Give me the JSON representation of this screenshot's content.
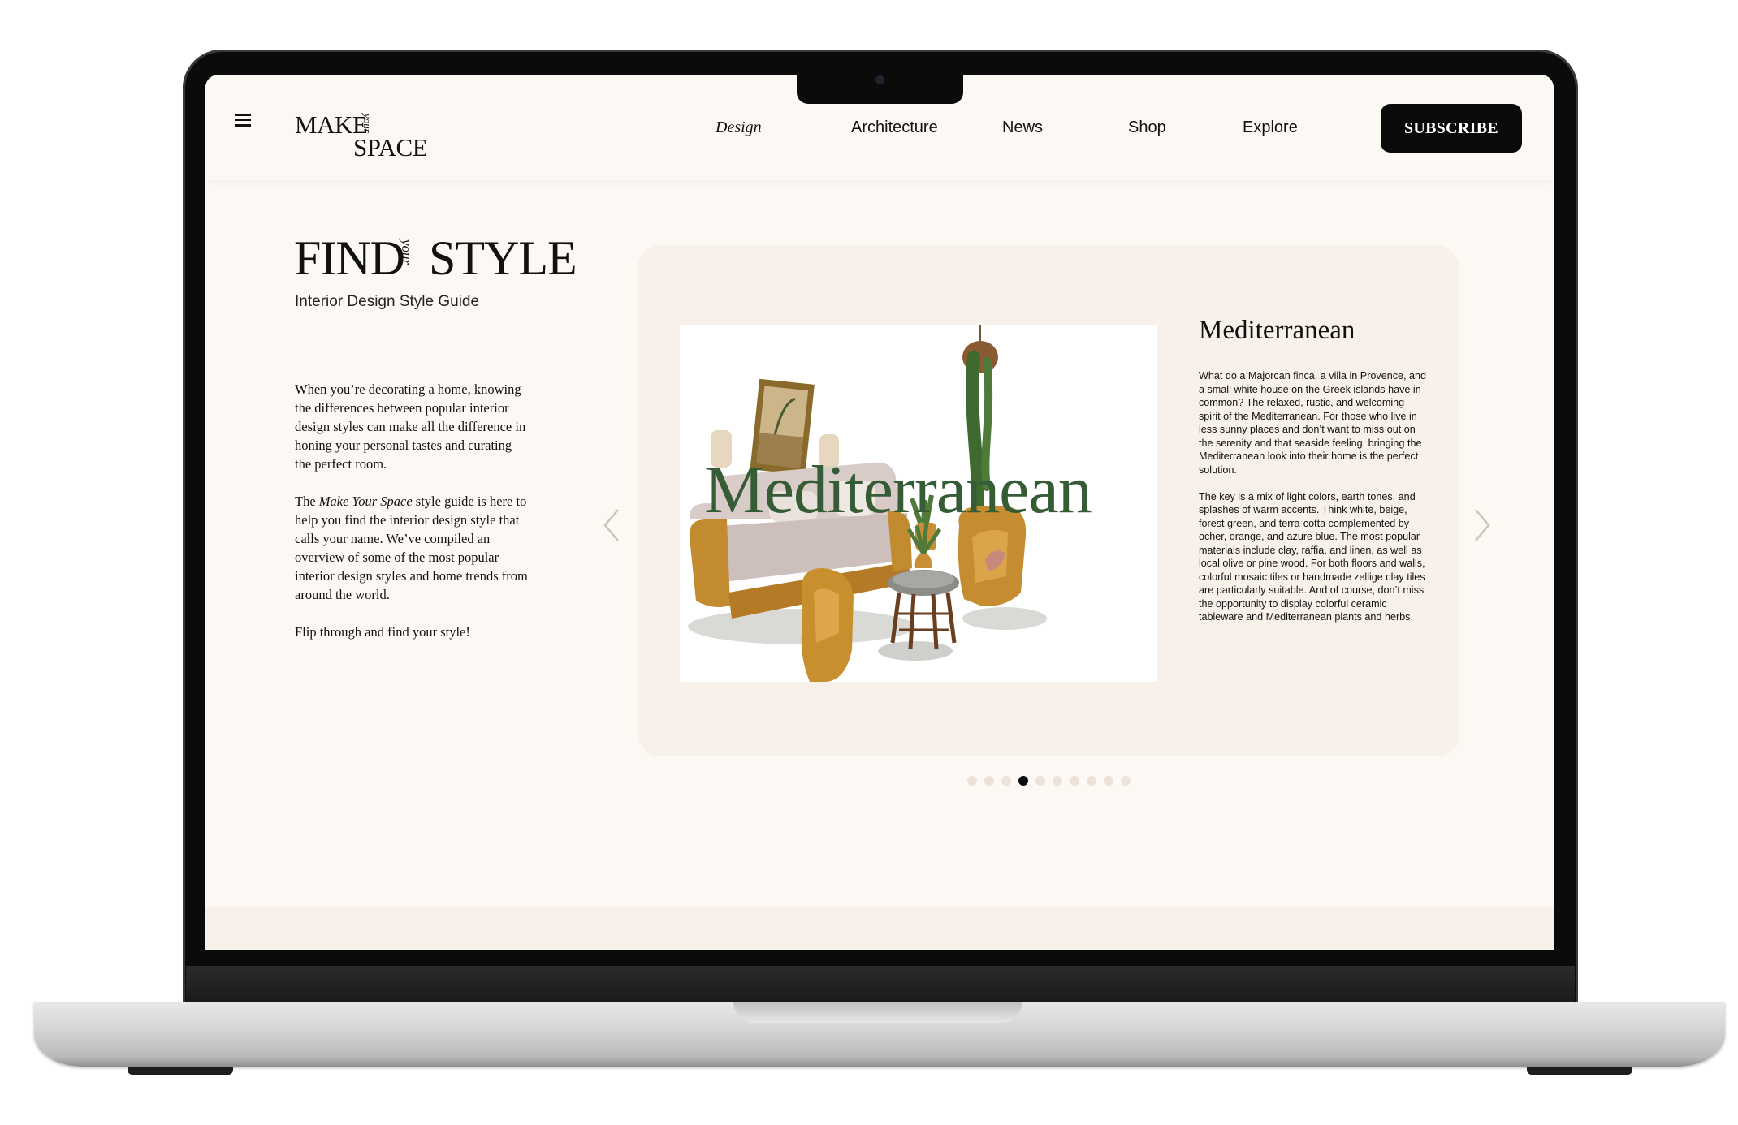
{
  "header": {
    "logo": {
      "line1": "MAKE",
      "middle": "your",
      "line2": "SPACE"
    },
    "nav": [
      "Design",
      "Architecture",
      "News",
      "Shop",
      "Explore"
    ],
    "subscribe_label": "SUBSCRIBE"
  },
  "hero": {
    "title_left": "FIND",
    "title_middle": "your",
    "title_right": "STYLE",
    "subtitle": "Interior Design Style Guide",
    "paragraph1": "When you’re decorating a home, knowing the differences between popular interior design styles can make all the difference in honing your personal tastes and curating the perfect room.",
    "paragraph2_prefix": "The ",
    "paragraph2_emphasis": "Make Your Space",
    "paragraph2_suffix": " style guide is here to help you find the interior design style that calls your name. We’ve compiled an overview of some of the most popular interior design styles and home trends from around the world.",
    "paragraph3": "Flip through and find your style!"
  },
  "carousel": {
    "illustration_word": "Mediterranean",
    "style_title": "Mediterranean",
    "paragraph1": "What do a Majorcan finca, a villa in Provence, and a small white house on the Greek islands have in common? The relaxed, rustic, and welcoming spirit of the Mediterranean. For those who live in less sunny places and don’t want to miss out on the serenity and that seaside feeling, bringing the Mediterranean look into their home is the perfect solution.",
    "paragraph2": "The key is a mix of light colors, earth tones, and splashes of warm accents. Think white, beige, forest green, and terra-cotta complemented by ocher, orange, and azure blue. The most popular materials include clay, raffia, and linen, as well as local olive or pine wood. For both floors and walls, colorful mosaic tiles or handmade zellige clay tiles are particularly suitable. And of course, don’t miss the opportunity to display colorful ceramic tableware and Mediterranean plants and herbs.",
    "total_slides": 10,
    "active_slide": 4,
    "prev_icon": "chevron-left-icon",
    "next_icon": "chevron-right-icon"
  },
  "colors": {
    "page_bg": "#fcf9f4",
    "card_bg": "#f8f1ea",
    "accent_green": "#355c34",
    "button_bg": "#0a0a0a",
    "dot_inactive": "#ece2d8"
  }
}
